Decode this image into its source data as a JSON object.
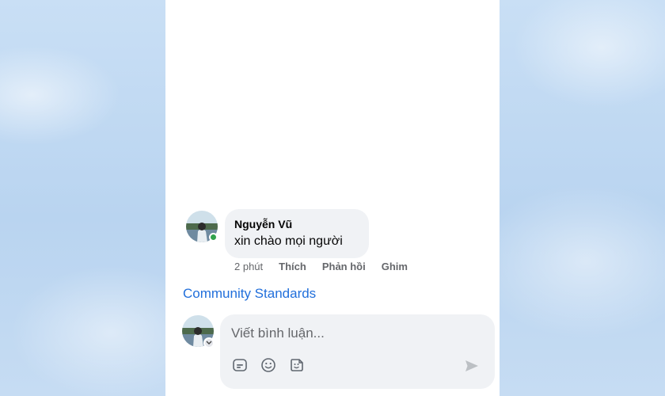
{
  "comment": {
    "author": "Nguyễn Vũ",
    "text": "xin chào mọi người",
    "time": "2 phút",
    "actions": {
      "like": "Thích",
      "reply": "Phản hồi",
      "pin": "Ghim"
    },
    "online": true
  },
  "links": {
    "community_standards": "Community Standards"
  },
  "composer": {
    "placeholder": "Viết bình luận..."
  },
  "icons": [
    "avatar",
    "online-status",
    "gif-icon",
    "emoji-icon",
    "sticker-icon",
    "send-icon",
    "chevron-down-icon"
  ],
  "colors": {
    "link": "#216fdb",
    "online": "#31a24c",
    "bubble": "#f0f2f5"
  }
}
